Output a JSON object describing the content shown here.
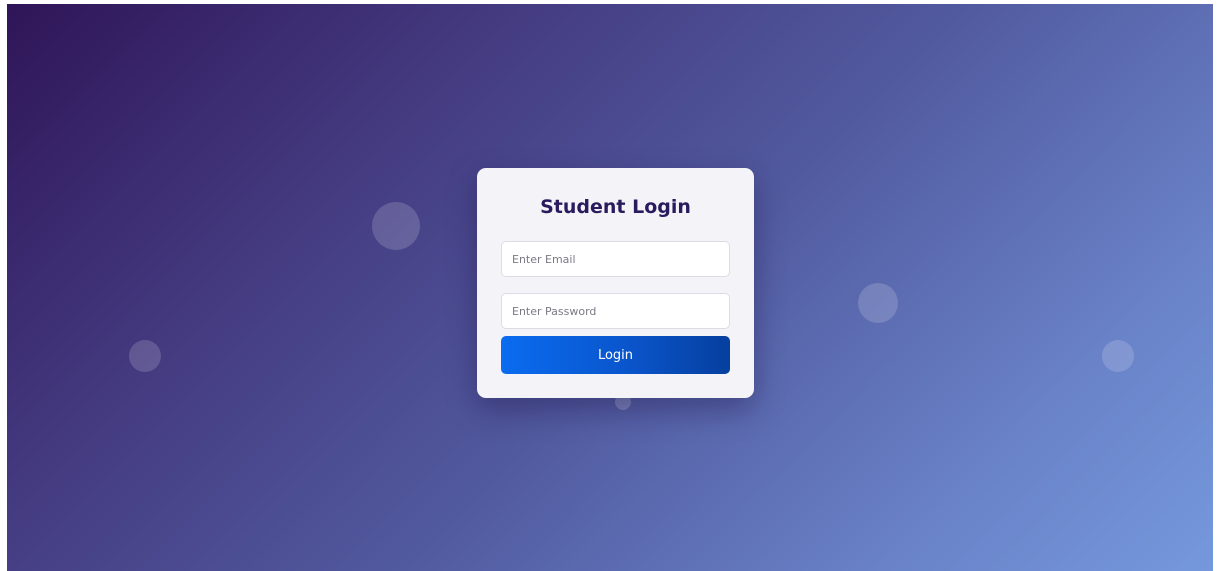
{
  "login_card": {
    "title": "Student Login",
    "email_placeholder": "Enter Email",
    "password_placeholder": "Enter Password",
    "login_label": "Login"
  },
  "colors": {
    "title": "#2a1a5e",
    "button": "#0a6cf0",
    "background_start": "#2f1558",
    "background_end": "#7598dc"
  }
}
